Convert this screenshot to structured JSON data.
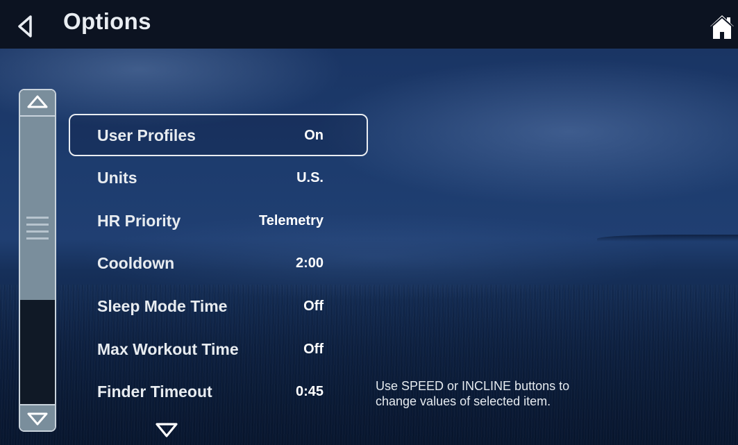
{
  "window": {
    "title": "Options",
    "back_icon": "back-triangle-icon",
    "home_icon": "home-icon"
  },
  "colors": {
    "title_bar": "#0c1321",
    "scroll_track": "#7a8e9c",
    "selection_border": "#e9edf2",
    "text": "#ffffff"
  },
  "scrollbar": {
    "up_icon": "scroll-up-triangle-icon",
    "down_icon": "scroll-down-triangle-icon",
    "grip_icon": "grip-lines-icon"
  },
  "options": [
    {
      "label": "User Profiles",
      "value": "On",
      "selected": true
    },
    {
      "label": "Units",
      "value": "U.S.",
      "selected": false
    },
    {
      "label": "HR Priority",
      "value": "Telemetry",
      "selected": false
    },
    {
      "label": "Cooldown",
      "value": "2:00",
      "selected": false
    },
    {
      "label": "Sleep Mode Time",
      "value": "Off",
      "selected": false
    },
    {
      "label": "Max Workout Time",
      "value": "Off",
      "selected": false
    },
    {
      "label": "Finder Timeout",
      "value": "0:45",
      "selected": false
    }
  ],
  "more_icon": "more-down-triangle-icon",
  "hint": {
    "line1": "Use SPEED or INCLINE buttons to",
    "line2": "change values of selected item."
  }
}
